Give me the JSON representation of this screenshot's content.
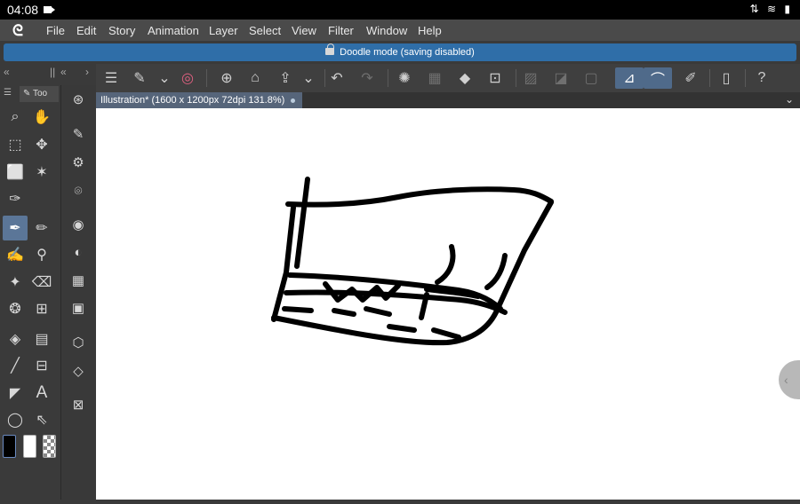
{
  "status": {
    "time": "04:08",
    "icons": "⇅ ≋ ▮"
  },
  "menu": {
    "logo": "ᘓ",
    "items": [
      "File",
      "Edit",
      "Story",
      "Animation",
      "Layer",
      "Select",
      "View",
      "Filter",
      "Window",
      "Help"
    ]
  },
  "info": {
    "text": "Doodle mode (saving disabled)"
  },
  "left_tabs": {
    "collapse": "«",
    "grip": "||",
    "collapse2": "«",
    "expand": "›",
    "menu_label": "Too"
  },
  "toolbar": {
    "buttons": [
      {
        "name": "hamburger-menu-icon",
        "glyph": "☰"
      },
      {
        "name": "edit-icon",
        "glyph": "✎"
      },
      {
        "name": "chevron-down-icon",
        "glyph": "⌄"
      },
      {
        "name": "spiral-icon",
        "glyph": "◎"
      },
      {
        "name": "new-file-icon",
        "glyph": "⊕"
      },
      {
        "name": "open-folder-icon",
        "glyph": "⌂"
      },
      {
        "name": "export-icon",
        "glyph": "⇪"
      },
      {
        "name": "chevron-down-icon",
        "glyph": "⌄"
      },
      {
        "name": "undo-icon",
        "glyph": "↶"
      },
      {
        "name": "redo-icon",
        "glyph": "↷"
      },
      {
        "name": "loading-icon",
        "glyph": "✺"
      },
      {
        "name": "grid-icon",
        "glyph": "▦"
      },
      {
        "name": "fill-icon",
        "glyph": "◆"
      },
      {
        "name": "crop-icon",
        "glyph": "⊡"
      },
      {
        "name": "mask-icon",
        "glyph": "▨"
      },
      {
        "name": "opacity-icon",
        "glyph": "◪"
      },
      {
        "name": "frame-icon",
        "glyph": "▢"
      },
      {
        "name": "ruler-icon",
        "glyph": "⊿"
      },
      {
        "name": "brush-stroke-icon",
        "glyph": "⌒"
      },
      {
        "name": "pen-line-icon",
        "glyph": "✐"
      },
      {
        "name": "device-icon",
        "glyph": "▯"
      },
      {
        "name": "help-icon",
        "glyph": "?"
      }
    ]
  },
  "document": {
    "tab_title": "Illustration* (1600 x 1200px 72dpi 131.8%)",
    "chevron": "⌄"
  },
  "tools": [
    {
      "name": "zoom-icon",
      "glyph": "⌕"
    },
    {
      "name": "hand-icon",
      "glyph": "✋"
    },
    {
      "name": "object-select-icon",
      "glyph": "⬚"
    },
    {
      "name": "move-icon",
      "glyph": "✥"
    },
    {
      "name": "rect-select-icon",
      "glyph": "⬜"
    },
    {
      "name": "magic-wand-icon",
      "glyph": "✶"
    },
    {
      "name": "eyedropper-icon",
      "glyph": "✑"
    },
    {
      "name": "pen-icon",
      "glyph": "✒"
    },
    {
      "name": "pencil-icon",
      "glyph": "✏"
    },
    {
      "name": "brush-icon",
      "glyph": "✍"
    },
    {
      "name": "airbrush-icon",
      "glyph": "⚲"
    },
    {
      "name": "decoration-icon",
      "glyph": "✦"
    },
    {
      "name": "eraser-icon",
      "glyph": "⌫"
    },
    {
      "name": "blend-icon",
      "glyph": "❂"
    },
    {
      "name": "mesh-icon",
      "glyph": "⊞"
    },
    {
      "name": "bucket-icon",
      "glyph": "◈"
    },
    {
      "name": "gradient-icon",
      "glyph": "▤"
    },
    {
      "name": "line-icon",
      "glyph": "╱"
    },
    {
      "name": "frame-border-icon",
      "glyph": "⊟"
    },
    {
      "name": "balloon-icon",
      "glyph": "◤"
    },
    {
      "name": "text-icon",
      "glyph": "A"
    },
    {
      "name": "lasso-icon",
      "glyph": "◯"
    },
    {
      "name": "correct-line-icon",
      "glyph": "⇖"
    }
  ],
  "subtools": [
    {
      "name": "sub-search-icon",
      "glyph": "⊛"
    },
    {
      "name": "sub-edit-icon",
      "glyph": "✎"
    },
    {
      "name": "sub-settings-icon",
      "glyph": "⚙"
    },
    {
      "name": "sub-target-icon",
      "glyph": "⌾"
    },
    {
      "name": "sub-layer-icon",
      "glyph": "◉"
    },
    {
      "name": "sub-drops-icon",
      "glyph": "◐"
    },
    {
      "name": "sub-palette-icon",
      "glyph": "▦"
    },
    {
      "name": "sub-film-icon",
      "glyph": "▣"
    },
    {
      "name": "sub-3d-icon",
      "glyph": "⬡"
    },
    {
      "name": "sub-layers-icon",
      "glyph": "◇"
    },
    {
      "name": "sub-image-icon",
      "glyph": "⊠"
    }
  ],
  "colors": {
    "main": "#000000",
    "sub": "#ffffff"
  }
}
